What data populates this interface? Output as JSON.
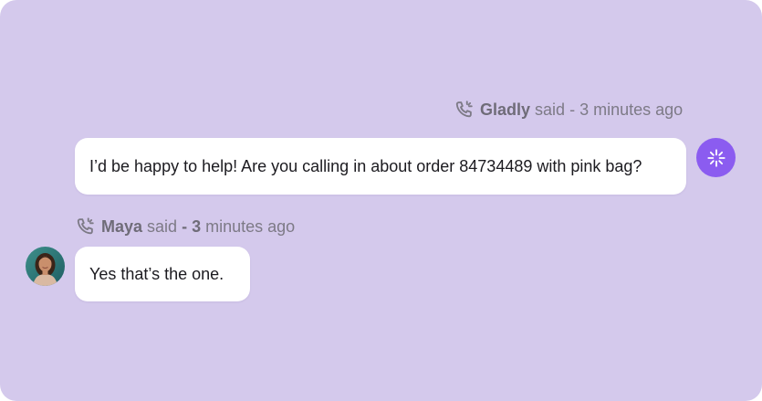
{
  "messages": [
    {
      "sender": "Gladly",
      "said": "said",
      "separator": "-",
      "time": "3 minutes ago",
      "text": "I’d be happy to help! Are you calling in about order 84734489 with pink bag?",
      "channel_icon": "phone-call-icon",
      "avatar_icon": "sparkle-icon"
    },
    {
      "sender": "Maya",
      "said": "said",
      "separator": "-",
      "time_number": "3",
      "time_rest": "minutes ago",
      "text": "Yes that’s the one.",
      "channel_icon": "phone-call-icon",
      "avatar_icon": "user-photo"
    }
  ],
  "colors": {
    "background": "#d4c9ec",
    "bubble": "#ffffff",
    "agent_avatar": "#8b5cf0",
    "meta_text": "#7d7a86"
  }
}
